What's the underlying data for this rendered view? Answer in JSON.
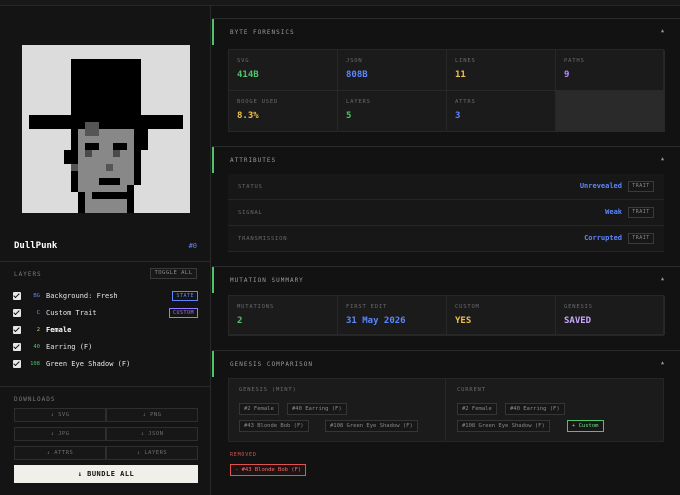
{
  "punk": {
    "name": "DullPunk",
    "id": "#0"
  },
  "layers": {
    "title": "LAYERS",
    "toggle_label": "TOGGLE ALL",
    "items": [
      {
        "code": "BG",
        "code_color": "#5b86ff",
        "name": "Background: Fresh",
        "tag": "STATE",
        "tag_color": "#5b86ff",
        "bold": false
      },
      {
        "code": "C",
        "code_color": "#9a7bff",
        "name": "Custom Trait",
        "tag": "CUSTOM",
        "tag_color": "#9a7bff",
        "bold": false
      },
      {
        "code": "2",
        "code_color": "#f0c24b",
        "name": "Female",
        "tag": "",
        "tag_color": "",
        "bold": true
      },
      {
        "code": "40",
        "code_color": "#4ec46a",
        "name": "Earring (F)",
        "tag": "",
        "tag_color": "",
        "bold": false
      },
      {
        "code": "108",
        "code_color": "#4ec46a",
        "name": "Green Eye Shadow (F)",
        "tag": "",
        "tag_color": "",
        "bold": false
      }
    ]
  },
  "downloads": {
    "title": "DOWNLOADS",
    "buttons": [
      "↓ SVG",
      "↓ PNG",
      "↓ JPG",
      "↓ JSON",
      "↓ ATTRS",
      "↓ LAYERS"
    ],
    "bundle_label": "↓ BUNDLE ALL"
  },
  "forensics": {
    "title": "BYTE FORENSICS",
    "cells": [
      {
        "label": "SVG",
        "value": "414B",
        "color": "#4ec46a"
      },
      {
        "label": "JSON",
        "value": "808B",
        "color": "#5b86ff"
      },
      {
        "label": "LINES",
        "value": "11",
        "color": "#f0c24b"
      },
      {
        "label": "PATHS",
        "value": "9",
        "color": "#b48cff"
      },
      {
        "label": "BOOGE USED",
        "value": "8.3%",
        "color": "#f0c24b"
      },
      {
        "label": "LAYERS",
        "value": "5",
        "color": "#4ec46a"
      },
      {
        "label": "ATTRS",
        "value": "3",
        "color": "#5b86ff"
      }
    ]
  },
  "attributes": {
    "title": "ATTRIBUTES",
    "trait_label": "TRAIT",
    "rows": [
      {
        "label": "STATUS",
        "value": "Unrevealed"
      },
      {
        "label": "SIGNAL",
        "value": "Weak"
      },
      {
        "label": "TRANSMISSION",
        "value": "Corrupted"
      }
    ]
  },
  "mutation": {
    "title": "MUTATION SUMMARY",
    "cells": [
      {
        "label": "MUTATIONS",
        "value": "2",
        "color": "#4ec46a"
      },
      {
        "label": "FIRST EDIT",
        "value": "31 May 2026",
        "color": "#5b86ff"
      },
      {
        "label": "CUSTOM",
        "value": "YES",
        "color": "#f0c24b"
      },
      {
        "label": "GENESIS",
        "value": "SAVED",
        "color": "#c9a8ff"
      }
    ]
  },
  "genesis": {
    "title": "GENESIS COMPARISON",
    "mint_label": "GENESIS (MINT)",
    "current_label": "CURRENT",
    "mint_chips": [
      "#2 Female",
      "#40 Earring (F)",
      "#43 Blonde Bob (F)",
      "#108 Green Eye Shadow (F)"
    ],
    "current_chips": [
      "#2 Female",
      "#40 Earring (F)",
      "#108 Green Eye Shadow (F)",
      "+ Custom"
    ],
    "removed_label": "REMOVED",
    "removed_chips": [
      "- #43 Blonde Bob (F)"
    ]
  }
}
